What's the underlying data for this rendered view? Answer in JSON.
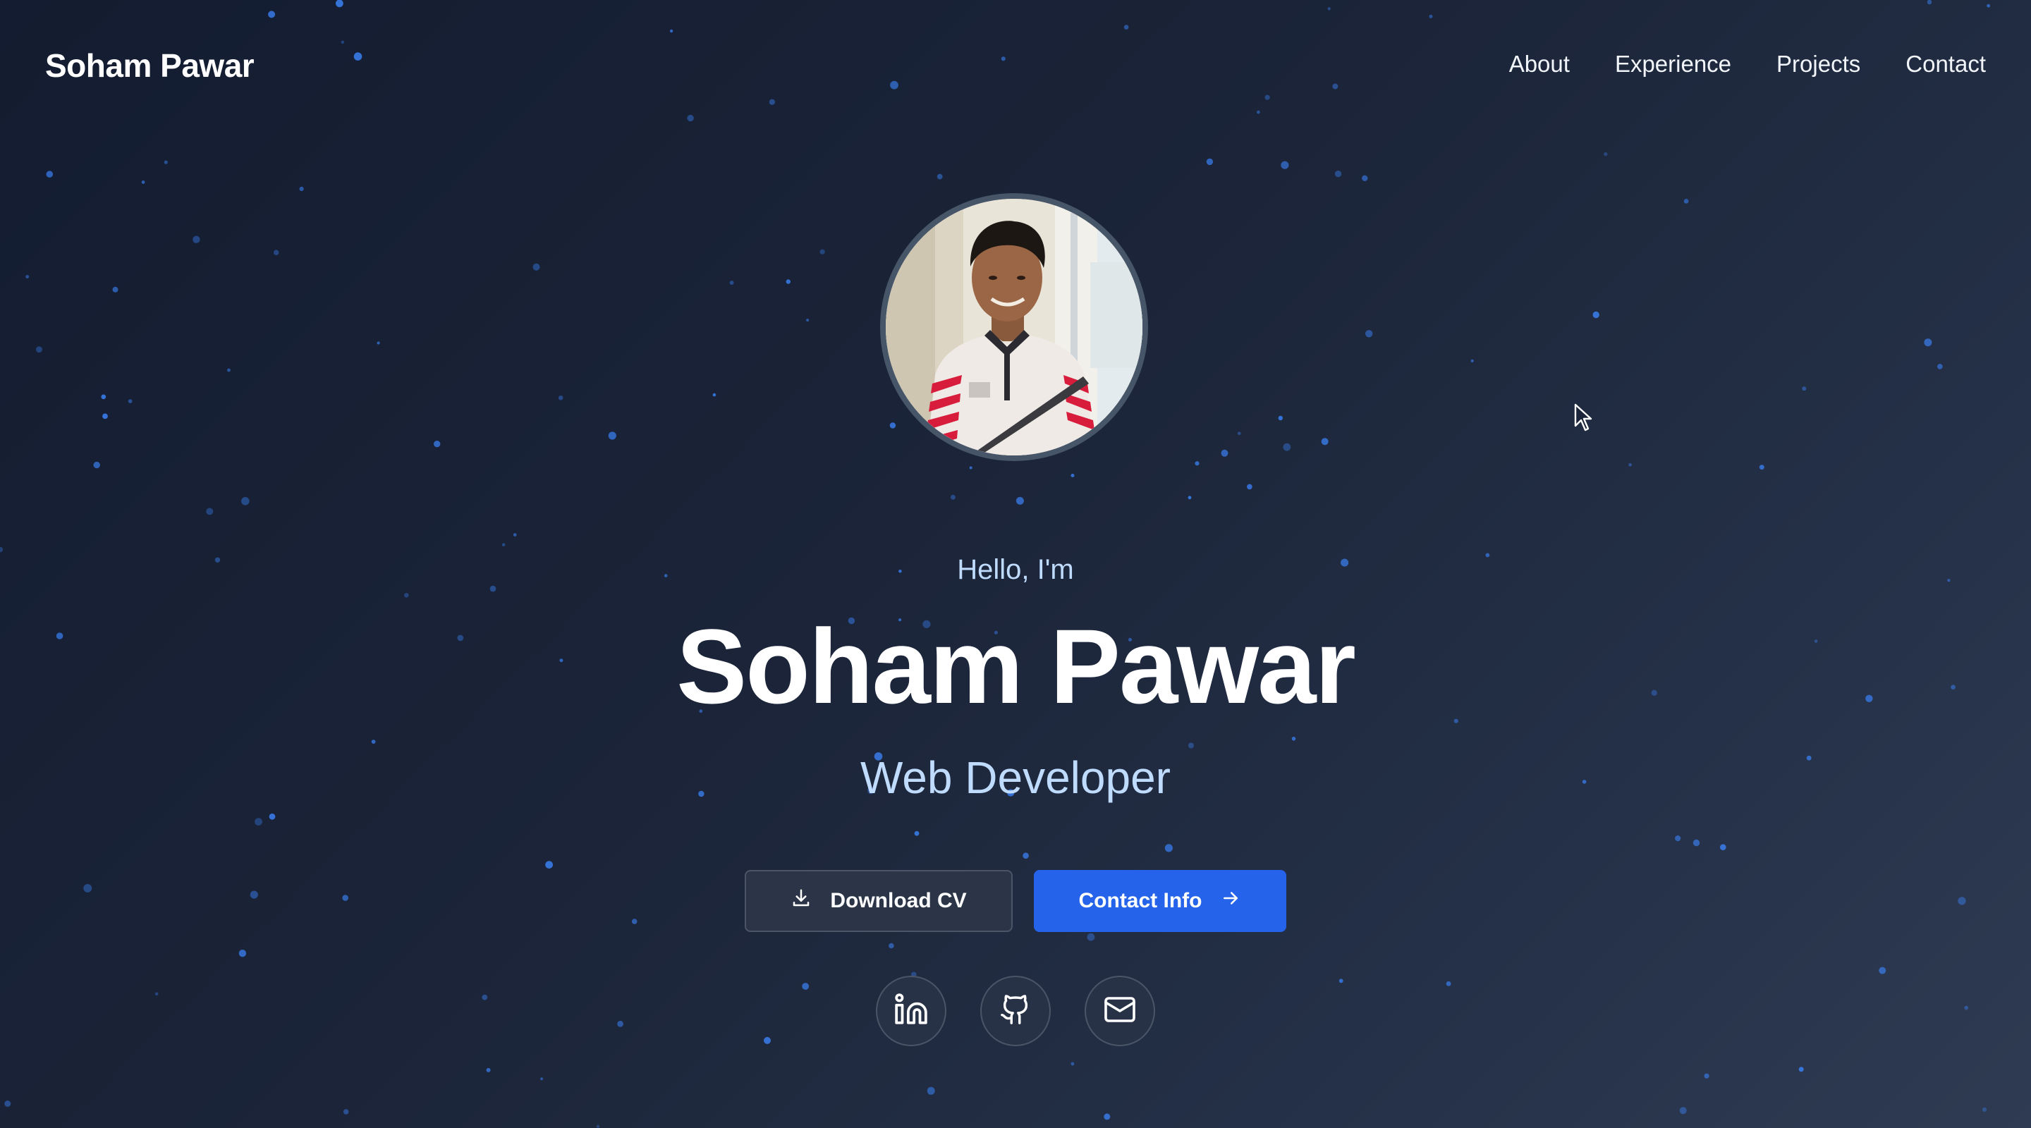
{
  "nav": {
    "brand": "Soham Pawar",
    "links": [
      {
        "label": "About"
      },
      {
        "label": "Experience"
      },
      {
        "label": "Projects"
      },
      {
        "label": "Contact"
      }
    ]
  },
  "hero": {
    "greeting": "Hello, I'm",
    "name": "Soham Pawar",
    "role": "Web Developer",
    "avatar_alt": "profile-photo",
    "buttons": {
      "download_cv": "Download CV",
      "contact_info": "Contact Info"
    },
    "social": [
      {
        "icon": "linkedin-icon"
      },
      {
        "icon": "github-icon"
      },
      {
        "icon": "mail-icon"
      }
    ]
  },
  "colors": {
    "accent": "#2563eb",
    "subtitle": "#bfdbfe",
    "background": "#1b2438",
    "star": "#3b82f6"
  }
}
